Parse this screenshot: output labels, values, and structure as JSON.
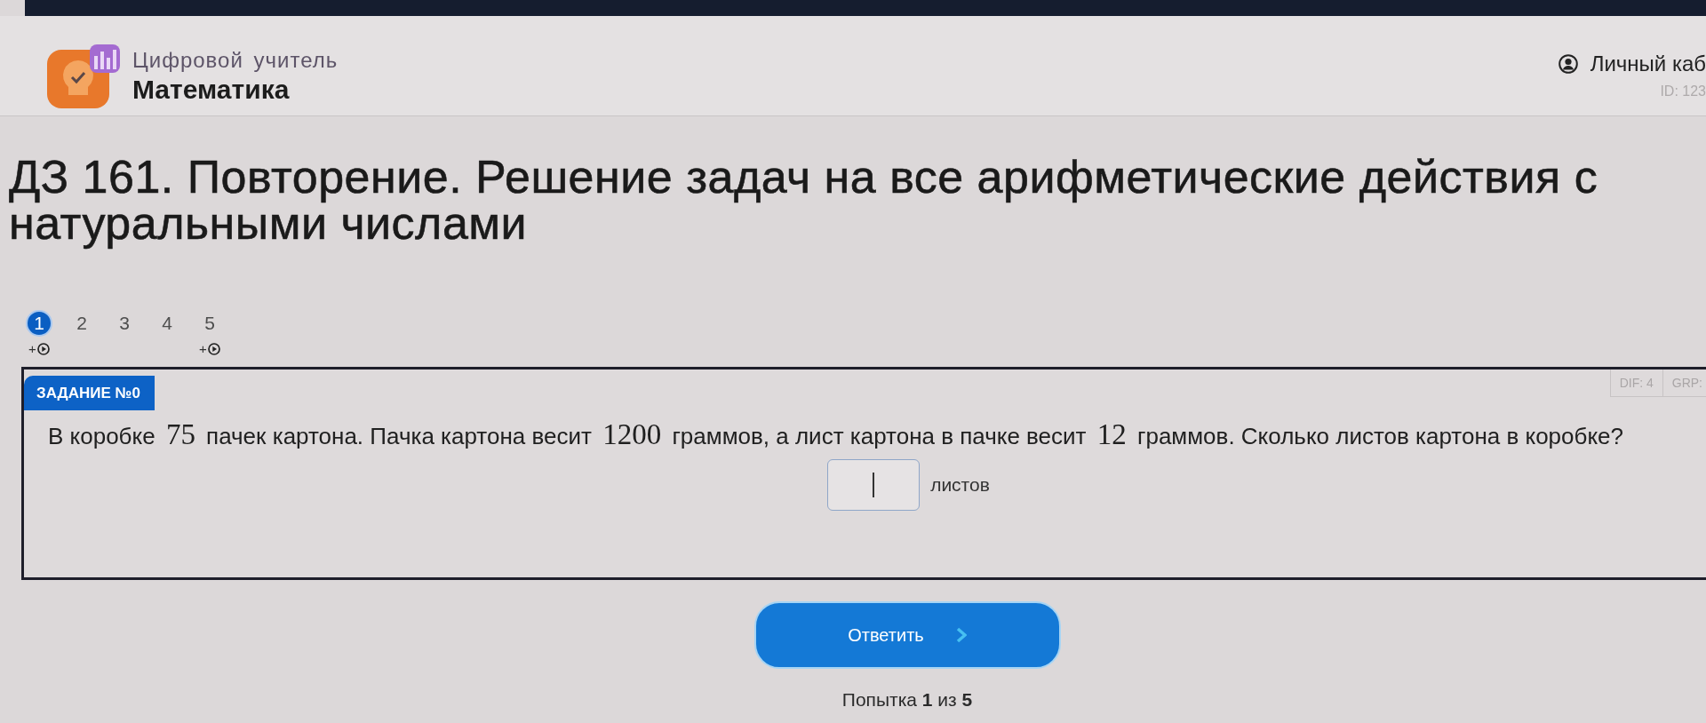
{
  "header": {
    "product": "Цифровой учитель",
    "subject": "Математика",
    "account": {
      "label": "Личный каб",
      "id": "ID: 123"
    }
  },
  "title": "ДЗ 161. Повторение. Решение задач на все арифметические действия с натуральными числами",
  "tasks": [
    {
      "label": "1",
      "selected": true,
      "video": true,
      "video_label": "+"
    },
    {
      "label": "2",
      "selected": false,
      "video": false
    },
    {
      "label": "3",
      "selected": false,
      "video": false
    },
    {
      "label": "4",
      "selected": false,
      "video": false
    },
    {
      "label": "5",
      "selected": false,
      "video": true,
      "video_label": "+"
    }
  ],
  "task_card": {
    "badge": "ЗАДАНИЕ №0",
    "meta": [
      "DIF: 4",
      "GRP:"
    ],
    "question": [
      {
        "kind": "text",
        "text": "В коробке"
      },
      {
        "kind": "math",
        "text": "75"
      },
      {
        "kind": "text",
        "text": "пачек картона. Пачка картона весит"
      },
      {
        "kind": "math",
        "text": "1200"
      },
      {
        "kind": "text",
        "text": "граммов, а лист картона в пачке весит"
      },
      {
        "kind": "math",
        "text": "12"
      },
      {
        "kind": "text",
        "text": "граммов. Сколько листов картона в коробке?"
      }
    ],
    "answer": {
      "focused": true,
      "unit": "листов"
    }
  },
  "submit": {
    "label": "Ответить"
  },
  "attempts": "Попытка **1** из **5**"
}
